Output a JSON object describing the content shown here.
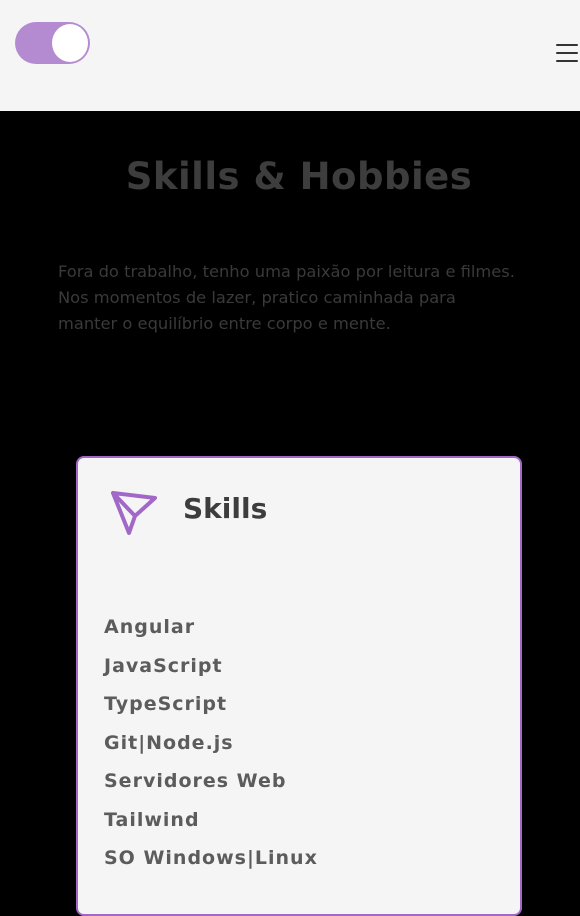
{
  "header": {
    "toggle_on": true,
    "toggle_color": "#b48ad0",
    "menu_icon": "hamburger-menu-icon"
  },
  "section": {
    "title": "Skills & Hobbies",
    "intro": "Fora do trabalho, tenho uma paixão por leitura e filmes. Nos momentos de lazer, pratico caminhada para manter o equilíbrio entre corpo e mente."
  },
  "card": {
    "icon": "send-icon",
    "accent_color": "#a268c8",
    "title": "Skills",
    "skills": [
      "Angular",
      "JavaScript",
      "TypeScript",
      "Git|Node.js",
      "Servidores Web",
      "Tailwind",
      "SO Windows|Linux"
    ]
  }
}
